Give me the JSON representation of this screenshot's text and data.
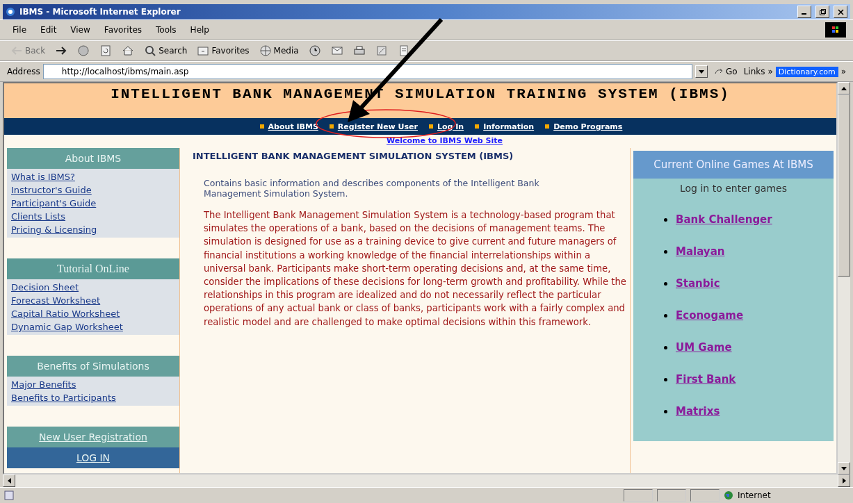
{
  "window": {
    "title": "IBMS - Microsoft Internet Explorer"
  },
  "menu": [
    "File",
    "Edit",
    "View",
    "Favorites",
    "Tools",
    "Help"
  ],
  "toolbar": [
    {
      "kind": "back",
      "label": "Back",
      "disabled": true
    },
    {
      "kind": "forward",
      "disabled": false
    },
    {
      "kind": "stop",
      "disabled": false
    },
    {
      "kind": "refresh",
      "disabled": false
    },
    {
      "kind": "home",
      "disabled": false
    },
    {
      "kind": "search",
      "label": "Search",
      "disabled": false
    },
    {
      "kind": "favorites",
      "label": "Favorites",
      "disabled": false
    },
    {
      "kind": "media",
      "label": "Media",
      "disabled": false
    },
    {
      "kind": "history",
      "disabled": false
    },
    {
      "kind": "mail",
      "disabled": false
    },
    {
      "kind": "print",
      "disabled": false
    },
    {
      "kind": "edit",
      "disabled": false
    },
    {
      "kind": "discuss",
      "disabled": false
    }
  ],
  "address": {
    "label": "Address",
    "value": "http://localhost/ibms/main.asp",
    "go": "Go",
    "links": "Links",
    "links_more": "»",
    "link": "Dictionary.com",
    "more": "»"
  },
  "page": {
    "banner": "INTELLIGENT BANK MANAGEMENT SIMULATION TRAINING SYSTEM (IBMS)",
    "nav": [
      "About IBMS",
      "Register New User",
      "Log In",
      "Information",
      "Demo Programs"
    ],
    "welcome": "Welcome to IBMS Web Site",
    "sidebar": [
      {
        "kind": "section",
        "title": "About IBMS",
        "links": [
          "What is IBMS?",
          "Instructor's Guide",
          "Participant's Guide",
          "Clients Lists",
          "Pricing & Licensing"
        ]
      },
      {
        "kind": "section",
        "title": "Tutorial OnLine",
        "links": [
          "Decision Sheet",
          "Forecast Worksheet",
          "Capital Ratio Worksheet",
          "Dynamic Gap Worksheet"
        ]
      },
      {
        "kind": "section",
        "title": "Benefits of Simulations",
        "links": [
          "Major Benefits",
          "Benefits to Participants"
        ]
      },
      {
        "kind": "register",
        "title": "New User Registration"
      },
      {
        "kind": "login",
        "title": "LOG IN"
      }
    ],
    "main": {
      "title": "INTELLIGENT BANK MANAGEMENT SIMULATION SYSTEM (IBMS)",
      "intro": "Contains basic information and describes components of the Intelligent Bank Management Simulation System.",
      "body": "The Intelligent Bank Management Simulation System is a technology-based program that simulates the operations of a bank, based on the decisions of management teams. The simulation is designed for use as a training device to give current and future managers of financial institutions a working knowledge of the financial interrelationships within a universal bank. Participants make short-term operating decisions and, at the same time, consider the implications of these decisions for long-term growth and profitability. While the relationships in this program are idealized and do not necessarily reflect the particular operations of any actual bank or class of banks, participants work with a fairly complex and realistic model and are challenged to make optimal decisions within this framework."
    },
    "games": {
      "title": "Current Online Games At IBMS",
      "hint": "Log in to enter games",
      "items": [
        "Bank Challenger",
        "Malayan",
        "Stanbic",
        "Econogame",
        "UM Game",
        "First Bank",
        "Matrixs"
      ]
    }
  },
  "status": {
    "zone": "Internet"
  }
}
